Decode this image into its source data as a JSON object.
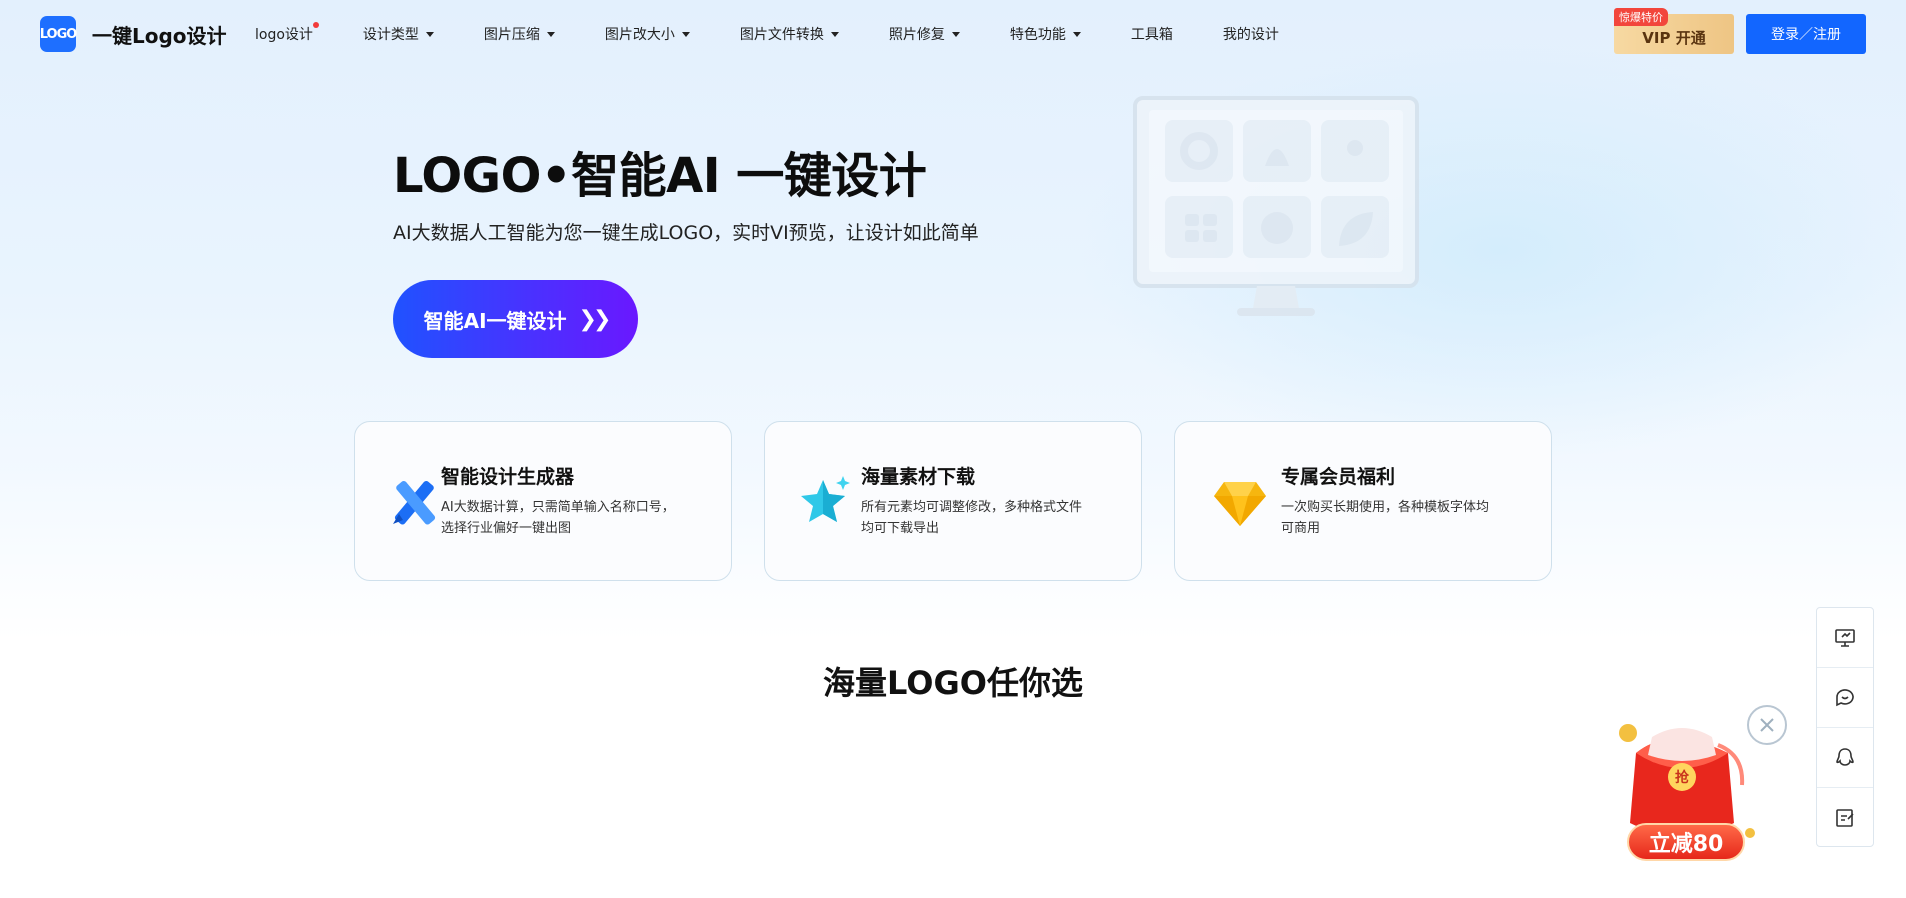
{
  "brand": {
    "logo_mark": "LOGO",
    "name": "一键Logo设计"
  },
  "nav": [
    {
      "label": "logo设计",
      "dot": true,
      "caret": false
    },
    {
      "label": "设计类型",
      "caret": true
    },
    {
      "label": "图片压缩",
      "caret": true
    },
    {
      "label": "图片改大小",
      "caret": true
    },
    {
      "label": "图片文件转换",
      "caret": true
    },
    {
      "label": "照片修复",
      "caret": true
    },
    {
      "label": "特色功能",
      "caret": true
    },
    {
      "label": "工具箱",
      "caret": false
    },
    {
      "label": "我的设计",
      "caret": false
    }
  ],
  "header": {
    "vip_badge": "惊爆特价",
    "vip_label": "VIP 开通",
    "login_label": "登录／注册"
  },
  "hero": {
    "title": "LOGO•智能AI 一键设计",
    "subtitle": "AI大数据人工智能为您一键生成LOGO，实时VI预览，让设计如此简单",
    "cta": "智能AI一键设计"
  },
  "features": [
    {
      "title": "智能设计生成器",
      "desc_line1": "AI大数据计算，只需简单输入名称口号，",
      "desc_line2": "选择行业偏好一键出图",
      "icon": "pencil-ruler-icon"
    },
    {
      "title": "海量素材下载",
      "desc_line1": "所有元素均可调整修改，多种格式文件",
      "desc_line2": "均可下载导出",
      "icon": "star-icon"
    },
    {
      "title": "专属会员福利",
      "desc_line1": "一次购买长期使用，各种模板字体均",
      "desc_line2": "可商用",
      "icon": "diamond-icon"
    }
  ],
  "section": {
    "title": "海量LOGO任你选"
  },
  "side_toolbar": [
    "monitor-icon",
    "chat-heart-icon",
    "qq-penguin-icon",
    "edit-note-icon"
  ],
  "promo": {
    "label": "立减80",
    "badge": "抢"
  },
  "colors": {
    "primary": "#1266ff",
    "cta_start": "#2052ff",
    "cta_end": "#6a18ff",
    "dot": "#f23b3b"
  }
}
